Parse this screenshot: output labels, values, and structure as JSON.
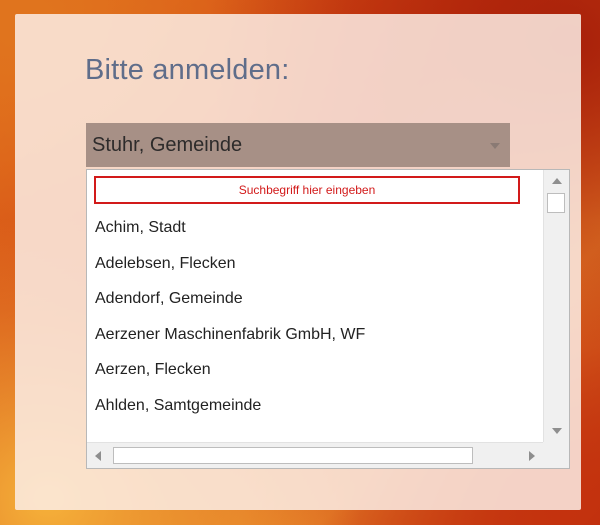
{
  "login": {
    "title": "Bitte anmelden:",
    "selected_value": "Stuhr, Gemeinde"
  },
  "dropdown": {
    "search_placeholder": "Suchbegriff hier eingeben",
    "items": [
      "Achim, Stadt",
      "Adelebsen, Flecken",
      "Adendorf, Gemeinde",
      "Aerzener Maschinenfabrik GmbH, WF",
      "Aerzen, Flecken",
      "Ahlden, Samtgemeinde"
    ]
  },
  "icons": {
    "select_arrow": "chevron-down-icon",
    "scroll_up": "scroll-up-arrow-icon",
    "scroll_down": "scroll-down-arrow-icon",
    "scroll_left": "scroll-left-arrow-icon",
    "scroll_right": "scroll-right-arrow-icon"
  },
  "colors": {
    "accent_red": "#d21a1a",
    "title_color": "#5f6d8a",
    "select_bg": "#a79086"
  }
}
